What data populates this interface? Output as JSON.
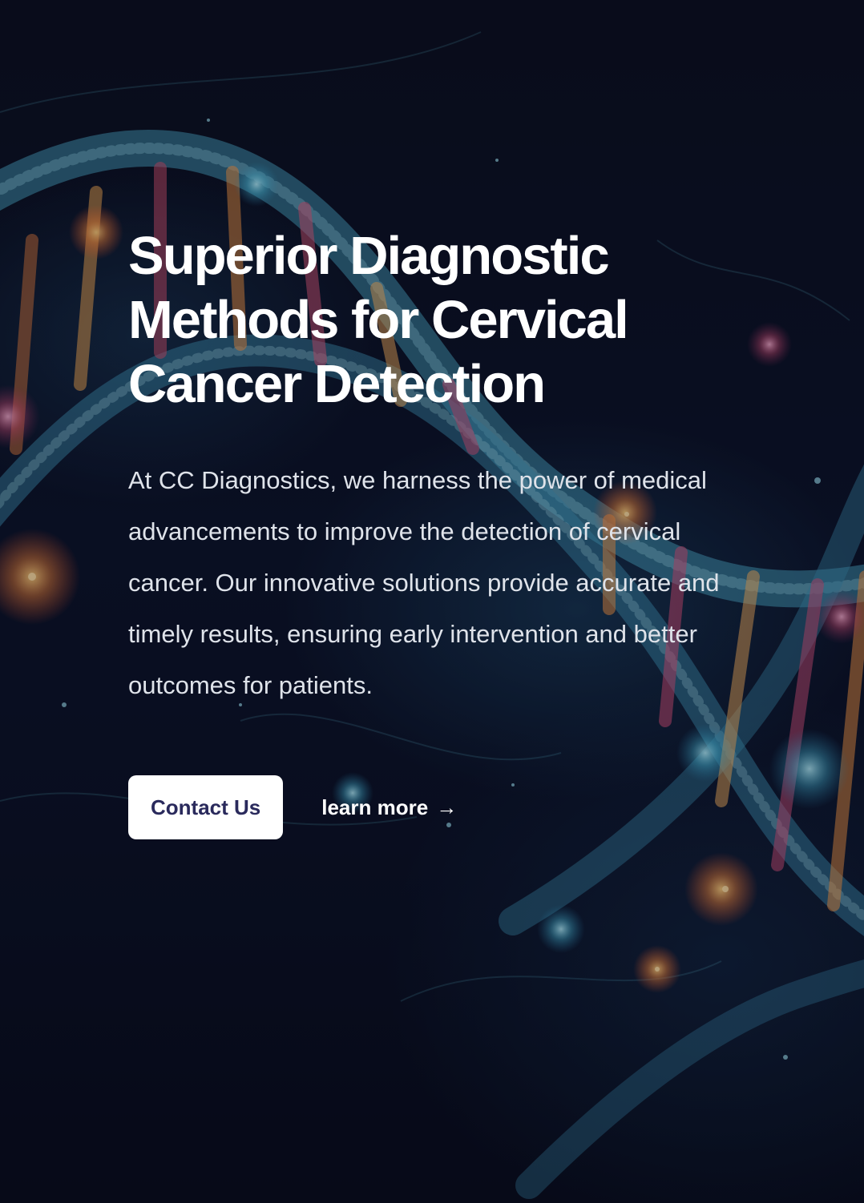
{
  "hero": {
    "title": "Superior Diagnostic Methods for Cervical Cancer Detection",
    "description": "At CC Diagnostics, we harness the power of medical advancements to improve the detection of cervical cancer. Our innovative solutions provide accurate and timely results, ensuring early intervention and better outcomes for patients.",
    "primary_button_label": "Contact Us",
    "secondary_link_label": "learn more",
    "secondary_link_icon": "arrow-right-icon"
  },
  "colors": {
    "background": "#0a0f22",
    "title_text": "#ffffff",
    "body_text": "#dfe3ea",
    "button_background": "#ffffff",
    "button_text": "#2a2a5c"
  }
}
